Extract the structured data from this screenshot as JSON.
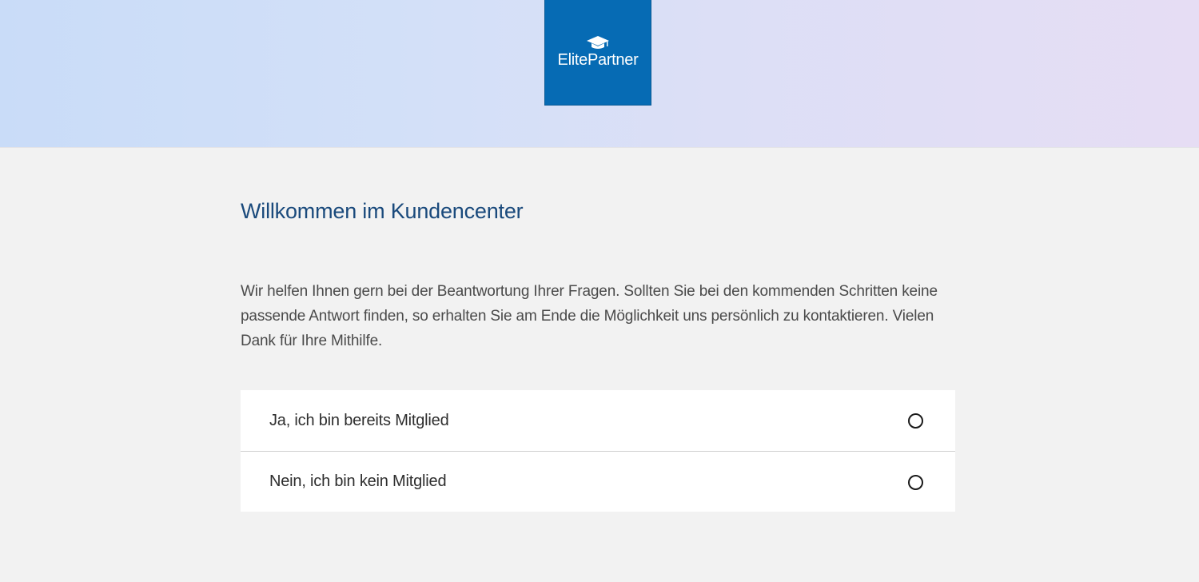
{
  "header": {
    "logo_text": "ElitePartner",
    "logo_icon": "graduation-cap-icon",
    "brand_color": "#066bb4"
  },
  "main": {
    "title": "Willkommen im Kundencenter",
    "intro": "Wir helfen Ihnen gern bei der Beantwortung Ihrer Fragen. Sollten Sie bei den kommenden Schritten keine passende Antwort finden, so erhalten Sie am Ende die Möglichkeit uns persönlich zu kontaktieren. Vielen Dank für Ihre Mithilfe.",
    "options": [
      {
        "label": "Ja, ich bin bereits Mitglied",
        "selected": false
      },
      {
        "label": "Nein, ich bin kein Mitglied",
        "selected": false
      }
    ]
  }
}
